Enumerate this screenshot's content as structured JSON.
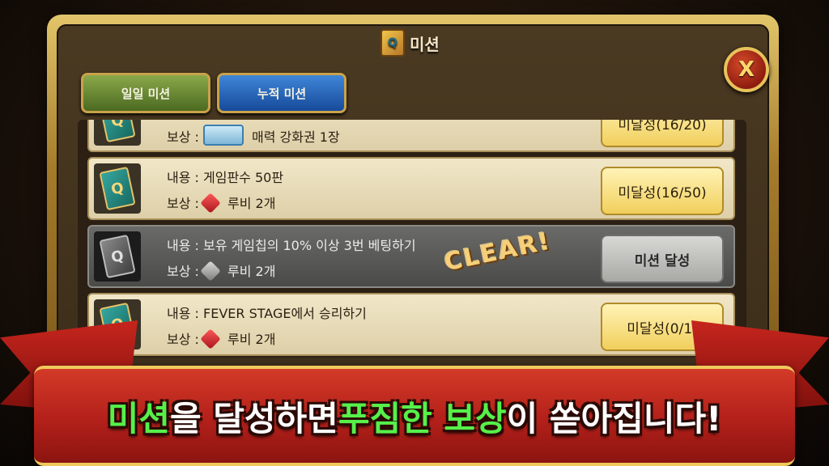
{
  "dialog": {
    "title": "미션",
    "close_label": "X"
  },
  "tabs": [
    {
      "label": "일일 미션"
    },
    {
      "label": "누적 미션"
    }
  ],
  "missions": [
    {
      "content_prefix": "보상 :",
      "reward": "매력 강화권 1장",
      "status": "미달성(16/20)",
      "reward_icon": "ticket-icon"
    },
    {
      "content_prefix": "내용 :",
      "content": "게임판수 50판",
      "reward_prefix": "보상 :",
      "reward": "루비 2개",
      "status": "미달성(16/50)",
      "reward_icon": "ruby-icon"
    },
    {
      "content_prefix": "내용 :",
      "content": "보유 게임칩의 10% 이상 3번 베팅하기",
      "reward_prefix": "보상 :",
      "reward": "루비 2개",
      "status": "미션 달성",
      "stamp": "CLEAR!",
      "reward_icon": "ruby-icon"
    },
    {
      "content_prefix": "내용 :",
      "content": "FEVER STAGE에서 승리하기",
      "reward_prefix": "보상 :",
      "reward": "루비 2개",
      "status": "미달성(0/1)",
      "reward_icon": "ruby-icon"
    }
  ],
  "card_letter": "Q",
  "banner": {
    "part1": "미션",
    "part2": "을 달성하면 ",
    "part3": "푸짐한 보상",
    "part4": "이 쏟아집니다!"
  },
  "colors": {
    "banner_red": "#c6251d",
    "highlight_green": "#56f04a",
    "gold": "#e2c56a"
  }
}
